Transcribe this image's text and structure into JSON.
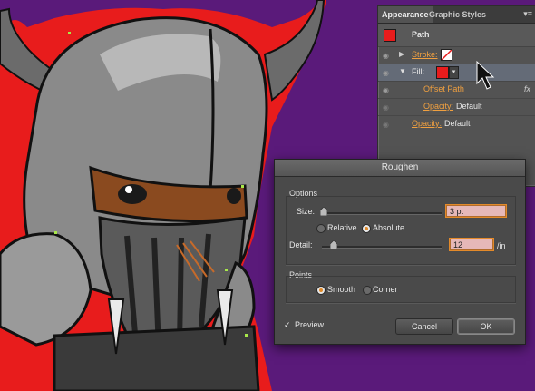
{
  "appearance_panel": {
    "tabs": [
      "Appearance",
      "Graphic Styles"
    ],
    "menu_glyph": "▾≡",
    "object_type": "Path",
    "rows": {
      "stroke": "Stroke:",
      "fill": "Fill:",
      "offset_path": "Offset Path",
      "fill_opacity_label": "Opacity:",
      "fill_opacity_value": "Default",
      "opacity_label": "Opacity:",
      "opacity_value": "Default",
      "fx": "fx"
    },
    "colors": {
      "fill": "#e81c1c"
    }
  },
  "roughen_dialog": {
    "title": "Roughen",
    "options_label": "Options",
    "size_label": "Size:",
    "size_value": "3 pt",
    "relative_label": "Relative",
    "absolute_label": "Absolute",
    "detail_label": "Detail:",
    "detail_value": "12",
    "detail_unit": "/in",
    "points_label": "Points",
    "smooth_label": "Smooth",
    "corner_label": "Corner",
    "preview_label": "Preview",
    "cancel_label": "Cancel",
    "ok_label": "OK",
    "selected_measure": "Absolute",
    "selected_points": "Smooth",
    "preview_checked": true
  },
  "colors": {
    "background": "#5a1a7a",
    "outline": "#e81c1c",
    "accent": "#e08a2a"
  }
}
